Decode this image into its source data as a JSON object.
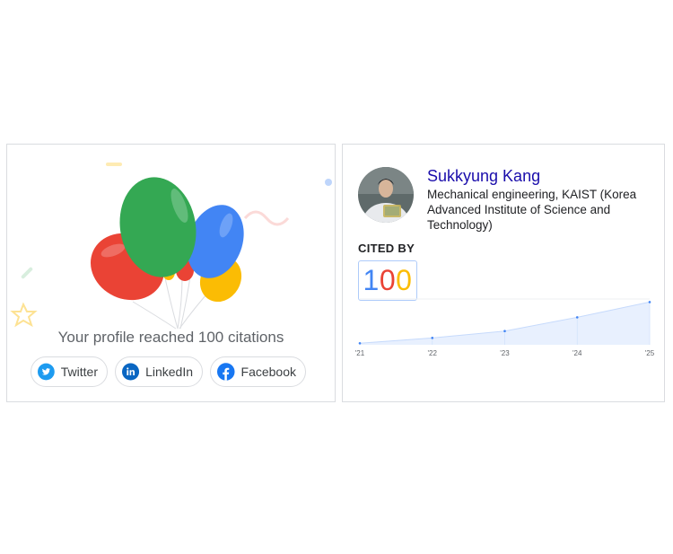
{
  "celebration": {
    "message": "Your profile reached 100 citations",
    "share_buttons": [
      {
        "label": "Twitter",
        "icon": "twitter-icon",
        "color": "#1d9bf0"
      },
      {
        "label": "LinkedIn",
        "icon": "linkedin-icon",
        "color": "#0a66c2"
      },
      {
        "label": "Facebook",
        "icon": "facebook-icon",
        "color": "#1877f2"
      }
    ],
    "balloon_colors": [
      "#34a853",
      "#4285f4",
      "#ea4335",
      "#fbbc04"
    ]
  },
  "profile": {
    "name": "Sukkyung Kang",
    "affiliation": "Mechanical engineering, KAIST (Korea Advanced Institute of Science and Technology)",
    "cited_by_label": "CITED BY",
    "cited_by_digits": [
      {
        "char": "1",
        "color": "#4285f4"
      },
      {
        "char": "0",
        "color": "#ea4335"
      },
      {
        "char": "0",
        "color": "#fbbc04"
      }
    ]
  },
  "chart_data": {
    "type": "area",
    "x": [
      "'21",
      "'22",
      "'23",
      "'24",
      "'25"
    ],
    "values": [
      2,
      9,
      18,
      36,
      56
    ],
    "ylim": [
      0,
      60
    ],
    "grid": false,
    "color": "#4285f4"
  }
}
